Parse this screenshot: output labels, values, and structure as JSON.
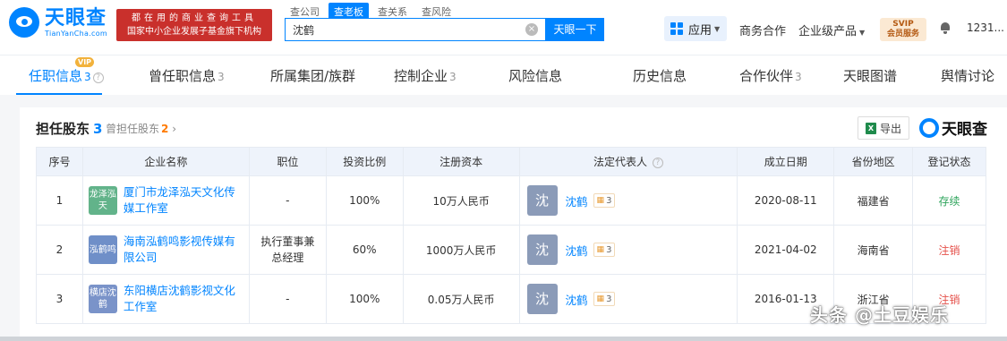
{
  "header": {
    "logo_cn": "天眼查",
    "logo_en": "TianYanCha.com",
    "banner_line1": "都在用的商业查询工具",
    "banner_line2": "国家中小企业发展子基金旗下机构",
    "search_tabs": [
      "查公司",
      "查老板",
      "查关系",
      "查风险"
    ],
    "search_value": "沈鹤",
    "search_button": "天眼一下",
    "apps_label": "应用",
    "nav_business": "商务合作",
    "nav_enterprise": "企业级产品",
    "svip_line1": "SVIP",
    "svip_line2": "会员服务",
    "user": "1231..."
  },
  "tabs": [
    {
      "label": "任职信息",
      "count": "3"
    },
    {
      "label": "曾任职信息",
      "count": "3"
    },
    {
      "label": "所属集团/族群",
      "count": ""
    },
    {
      "label": "控制企业",
      "count": "3"
    },
    {
      "label": "风险信息",
      "count": ""
    },
    {
      "label": "历史信息",
      "count": ""
    },
    {
      "label": "合作伙伴",
      "count": "3"
    },
    {
      "label": "天眼图谱",
      "count": ""
    },
    {
      "label": "舆情讨论",
      "count": ""
    }
  ],
  "vip_badge": "VIP",
  "section": {
    "title": "担任股东",
    "count": "3",
    "sub_label": "曾担任股东",
    "sub_count": "2",
    "export": "导出",
    "brand": "天眼查"
  },
  "table": {
    "headers": [
      "序号",
      "企业名称",
      "职位",
      "投资比例",
      "注册资本",
      "法定代表人",
      "成立日期",
      "省份地区",
      "登记状态"
    ],
    "rows": [
      {
        "idx": "1",
        "logo": "龙泽泓天",
        "logo_color": "#62b38a",
        "name": "厦门市龙泽泓天文化传媒工作室",
        "position": "-",
        "ratio": "100%",
        "capital": "10万人民币",
        "rep_avatar": "沈",
        "rep": "沈鹤",
        "rep_tag": "3",
        "date": "2020-08-11",
        "province": "福建省",
        "status": "存续",
        "status_color": "#2fa45c"
      },
      {
        "idx": "2",
        "logo": "泓鹤鸣",
        "logo_color": "#6f8fc8",
        "name": "海南泓鹤鸣影视传媒有限公司",
        "position": "执行董事兼总经理",
        "ratio": "60%",
        "capital": "1000万人民币",
        "rep_avatar": "沈",
        "rep": "沈鹤",
        "rep_tag": "3",
        "date": "2021-04-02",
        "province": "海南省",
        "status": "注销",
        "status_color": "#e5524c"
      },
      {
        "idx": "3",
        "logo": "横店沈鹤",
        "logo_color": "#7a93c9",
        "name": "东阳横店沈鹤影视文化工作室",
        "position": "-",
        "ratio": "100%",
        "capital": "0.05万人民币",
        "rep_avatar": "沈",
        "rep": "沈鹤",
        "rep_tag": "3",
        "date": "2016-01-13",
        "province": "浙江省",
        "status": "注销",
        "status_color": "#e5524c"
      }
    ]
  },
  "watermark": "头条 @土豆娱乐"
}
